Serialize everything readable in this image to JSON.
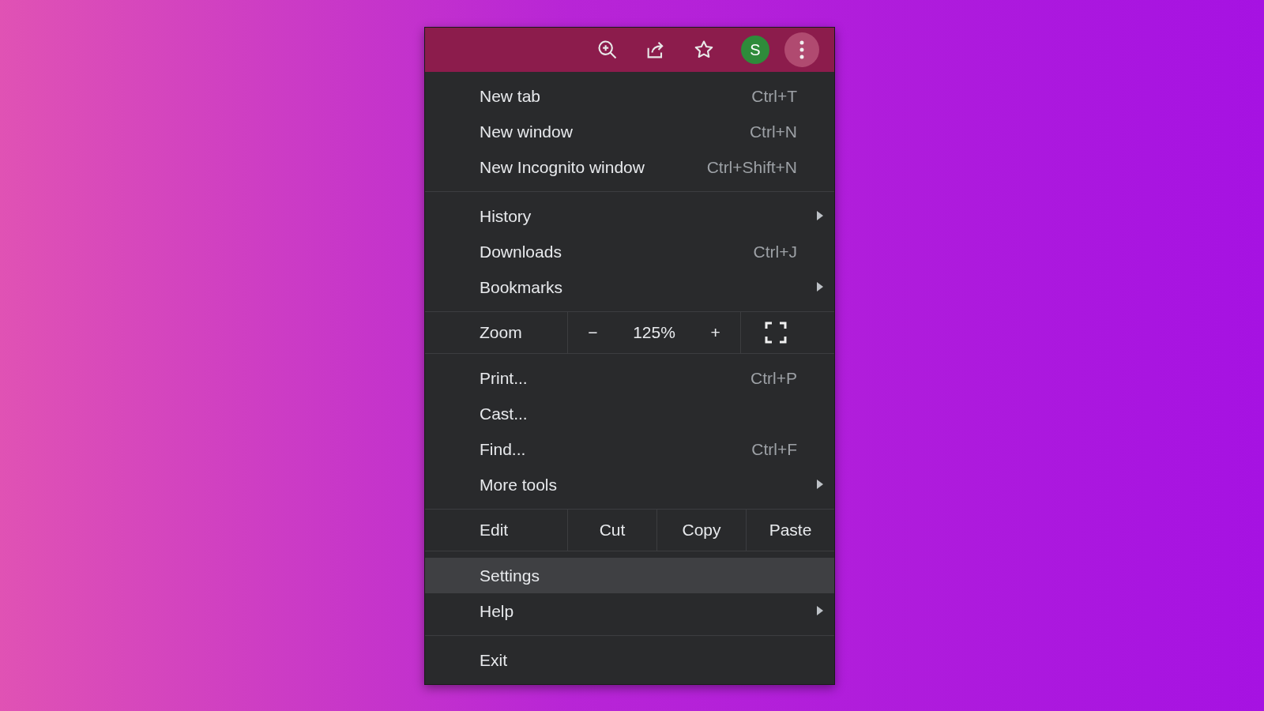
{
  "toolbar": {
    "avatar_letter": "S"
  },
  "menu": [
    {
      "kind": "group",
      "items": [
        {
          "label": "New tab",
          "shortcut": "Ctrl+T",
          "submenu": false,
          "selected": false
        },
        {
          "label": "New window",
          "shortcut": "Ctrl+N",
          "submenu": false,
          "selected": false
        },
        {
          "label": "New Incognito window",
          "shortcut": "Ctrl+Shift+N",
          "submenu": false,
          "selected": false
        }
      ]
    },
    {
      "kind": "group",
      "items": [
        {
          "label": "History",
          "submenu": true,
          "selected": false
        },
        {
          "label": "Downloads",
          "shortcut": "Ctrl+J",
          "submenu": false,
          "selected": false
        },
        {
          "label": "Bookmarks",
          "submenu": true,
          "selected": false
        }
      ]
    },
    {
      "kind": "zoom",
      "label": "Zoom",
      "minus": "−",
      "value": "125%",
      "plus": "+"
    },
    {
      "kind": "group",
      "items": [
        {
          "label": "Print...",
          "shortcut": "Ctrl+P",
          "submenu": false,
          "selected": false
        },
        {
          "label": "Cast...",
          "submenu": false,
          "selected": false
        },
        {
          "label": "Find...",
          "shortcut": "Ctrl+F",
          "submenu": false,
          "selected": false
        },
        {
          "label": "More tools",
          "submenu": true,
          "selected": false
        }
      ]
    },
    {
      "kind": "edit",
      "label": "Edit",
      "actions": [
        "Cut",
        "Copy",
        "Paste"
      ]
    },
    {
      "kind": "group",
      "items": [
        {
          "label": "Settings",
          "submenu": false,
          "selected": true
        },
        {
          "label": "Help",
          "submenu": true,
          "selected": false
        }
      ]
    },
    {
      "kind": "group",
      "items": [
        {
          "label": "Exit",
          "submenu": false,
          "selected": false
        }
      ]
    }
  ]
}
